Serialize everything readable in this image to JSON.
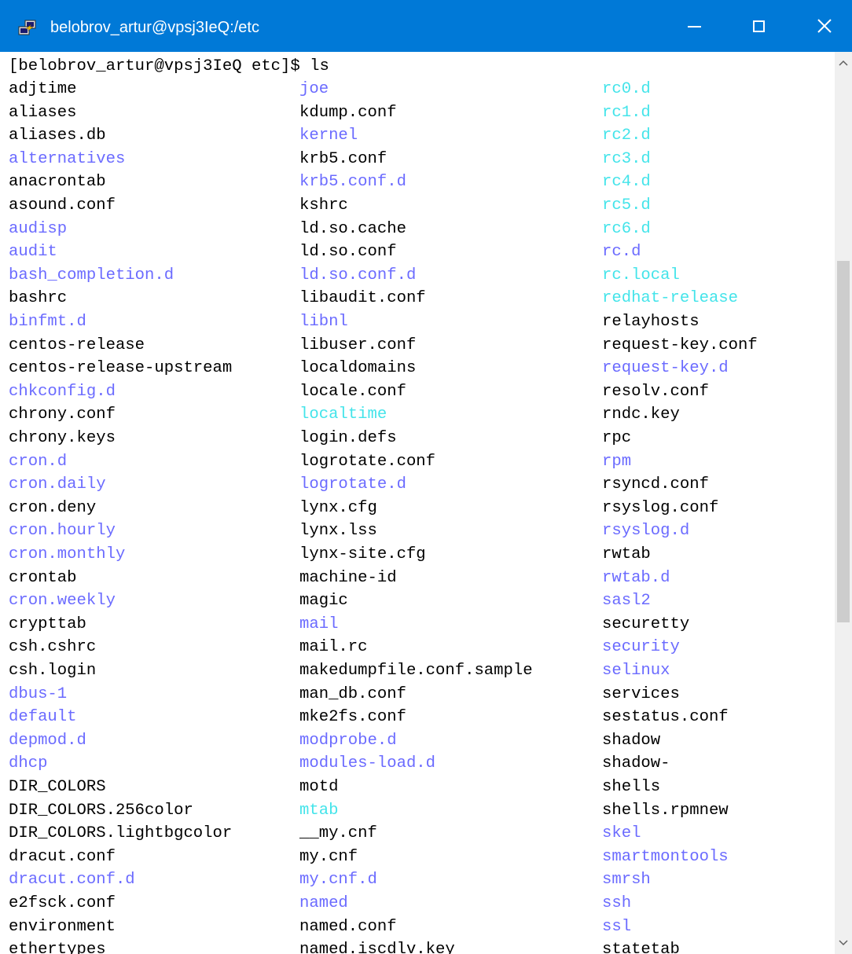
{
  "window": {
    "title": "belobrov_artur@vpsj3IeQ:/etc",
    "icon": "putty-icon",
    "buttons": [
      "minimize-icon",
      "maximize-icon",
      "close-icon"
    ]
  },
  "terminal": {
    "prompt": "[belobrov_artur@vpsj3IeQ etc]$ ls",
    "colors": {
      "background": "#ffffff",
      "file": "#000000",
      "directory": "#6b6bff",
      "symlink": "#44e4ea",
      "titlebar": "#0079d7"
    },
    "columns": [
      [
        {
          "name": "adjtime",
          "type": "file"
        },
        {
          "name": "aliases",
          "type": "file"
        },
        {
          "name": "aliases.db",
          "type": "file"
        },
        {
          "name": "alternatives",
          "type": "dir"
        },
        {
          "name": "anacrontab",
          "type": "file"
        },
        {
          "name": "asound.conf",
          "type": "file"
        },
        {
          "name": "audisp",
          "type": "dir"
        },
        {
          "name": "audit",
          "type": "dir"
        },
        {
          "name": "bash_completion.d",
          "type": "dir"
        },
        {
          "name": "bashrc",
          "type": "file"
        },
        {
          "name": "binfmt.d",
          "type": "dir"
        },
        {
          "name": "centos-release",
          "type": "file"
        },
        {
          "name": "centos-release-upstream",
          "type": "file"
        },
        {
          "name": "chkconfig.d",
          "type": "dir"
        },
        {
          "name": "chrony.conf",
          "type": "file"
        },
        {
          "name": "chrony.keys",
          "type": "file"
        },
        {
          "name": "cron.d",
          "type": "dir"
        },
        {
          "name": "cron.daily",
          "type": "dir"
        },
        {
          "name": "cron.deny",
          "type": "file"
        },
        {
          "name": "cron.hourly",
          "type": "dir"
        },
        {
          "name": "cron.monthly",
          "type": "dir"
        },
        {
          "name": "crontab",
          "type": "file"
        },
        {
          "name": "cron.weekly",
          "type": "dir"
        },
        {
          "name": "crypttab",
          "type": "file"
        },
        {
          "name": "csh.cshrc",
          "type": "file"
        },
        {
          "name": "csh.login",
          "type": "file"
        },
        {
          "name": "dbus-1",
          "type": "dir"
        },
        {
          "name": "default",
          "type": "dir"
        },
        {
          "name": "depmod.d",
          "type": "dir"
        },
        {
          "name": "dhcp",
          "type": "dir"
        },
        {
          "name": "DIR_COLORS",
          "type": "file"
        },
        {
          "name": "DIR_COLORS.256color",
          "type": "file"
        },
        {
          "name": "DIR_COLORS.lightbgcolor",
          "type": "file"
        },
        {
          "name": "dracut.conf",
          "type": "file"
        },
        {
          "name": "dracut.conf.d",
          "type": "dir"
        },
        {
          "name": "e2fsck.conf",
          "type": "file"
        },
        {
          "name": "environment",
          "type": "file"
        },
        {
          "name": "ethertypes",
          "type": "file"
        }
      ],
      [
        {
          "name": "joe",
          "type": "dir"
        },
        {
          "name": "kdump.conf",
          "type": "file"
        },
        {
          "name": "kernel",
          "type": "dir"
        },
        {
          "name": "krb5.conf",
          "type": "file"
        },
        {
          "name": "krb5.conf.d",
          "type": "dir"
        },
        {
          "name": "kshrc",
          "type": "file"
        },
        {
          "name": "ld.so.cache",
          "type": "file"
        },
        {
          "name": "ld.so.conf",
          "type": "file"
        },
        {
          "name": "ld.so.conf.d",
          "type": "dir"
        },
        {
          "name": "libaudit.conf",
          "type": "file"
        },
        {
          "name": "libnl",
          "type": "dir"
        },
        {
          "name": "libuser.conf",
          "type": "file"
        },
        {
          "name": "localdomains",
          "type": "file"
        },
        {
          "name": "locale.conf",
          "type": "file"
        },
        {
          "name": "localtime",
          "type": "link"
        },
        {
          "name": "login.defs",
          "type": "file"
        },
        {
          "name": "logrotate.conf",
          "type": "file"
        },
        {
          "name": "logrotate.d",
          "type": "dir"
        },
        {
          "name": "lynx.cfg",
          "type": "file"
        },
        {
          "name": "lynx.lss",
          "type": "file"
        },
        {
          "name": "lynx-site.cfg",
          "type": "file"
        },
        {
          "name": "machine-id",
          "type": "file"
        },
        {
          "name": "magic",
          "type": "file"
        },
        {
          "name": "mail",
          "type": "dir"
        },
        {
          "name": "mail.rc",
          "type": "file"
        },
        {
          "name": "makedumpfile.conf.sample",
          "type": "file"
        },
        {
          "name": "man_db.conf",
          "type": "file"
        },
        {
          "name": "mke2fs.conf",
          "type": "file"
        },
        {
          "name": "modprobe.d",
          "type": "dir"
        },
        {
          "name": "modules-load.d",
          "type": "dir"
        },
        {
          "name": "motd",
          "type": "file"
        },
        {
          "name": "mtab",
          "type": "link"
        },
        {
          "name": "__my.cnf",
          "type": "file"
        },
        {
          "name": "my.cnf",
          "type": "file"
        },
        {
          "name": "my.cnf.d",
          "type": "dir"
        },
        {
          "name": "named",
          "type": "dir"
        },
        {
          "name": "named.conf",
          "type": "file"
        },
        {
          "name": "named.iscdlv.key",
          "type": "file"
        }
      ],
      [
        {
          "name": "rc0.d",
          "type": "link"
        },
        {
          "name": "rc1.d",
          "type": "link"
        },
        {
          "name": "rc2.d",
          "type": "link"
        },
        {
          "name": "rc3.d",
          "type": "link"
        },
        {
          "name": "rc4.d",
          "type": "link"
        },
        {
          "name": "rc5.d",
          "type": "link"
        },
        {
          "name": "rc6.d",
          "type": "link"
        },
        {
          "name": "rc.d",
          "type": "dir"
        },
        {
          "name": "rc.local",
          "type": "link"
        },
        {
          "name": "redhat-release",
          "type": "link"
        },
        {
          "name": "relayhosts",
          "type": "file"
        },
        {
          "name": "request-key.conf",
          "type": "file"
        },
        {
          "name": "request-key.d",
          "type": "dir"
        },
        {
          "name": "resolv.conf",
          "type": "file"
        },
        {
          "name": "rndc.key",
          "type": "file"
        },
        {
          "name": "rpc",
          "type": "file"
        },
        {
          "name": "rpm",
          "type": "dir"
        },
        {
          "name": "rsyncd.conf",
          "type": "file"
        },
        {
          "name": "rsyslog.conf",
          "type": "file"
        },
        {
          "name": "rsyslog.d",
          "type": "dir"
        },
        {
          "name": "rwtab",
          "type": "file"
        },
        {
          "name": "rwtab.d",
          "type": "dir"
        },
        {
          "name": "sasl2",
          "type": "dir"
        },
        {
          "name": "securetty",
          "type": "file"
        },
        {
          "name": "security",
          "type": "dir"
        },
        {
          "name": "selinux",
          "type": "dir"
        },
        {
          "name": "services",
          "type": "file"
        },
        {
          "name": "sestatus.conf",
          "type": "file"
        },
        {
          "name": "shadow",
          "type": "file"
        },
        {
          "name": "shadow-",
          "type": "file"
        },
        {
          "name": "shells",
          "type": "file"
        },
        {
          "name": "shells.rpmnew",
          "type": "file"
        },
        {
          "name": "skel",
          "type": "dir"
        },
        {
          "name": "smartmontools",
          "type": "dir"
        },
        {
          "name": "smrsh",
          "type": "dir"
        },
        {
          "name": "ssh",
          "type": "dir"
        },
        {
          "name": "ssl",
          "type": "dir"
        },
        {
          "name": "statetab",
          "type": "file"
        }
      ]
    ]
  },
  "scrollbar": {
    "up_icon": "chevron-up-icon",
    "down_icon": "chevron-down-icon"
  }
}
